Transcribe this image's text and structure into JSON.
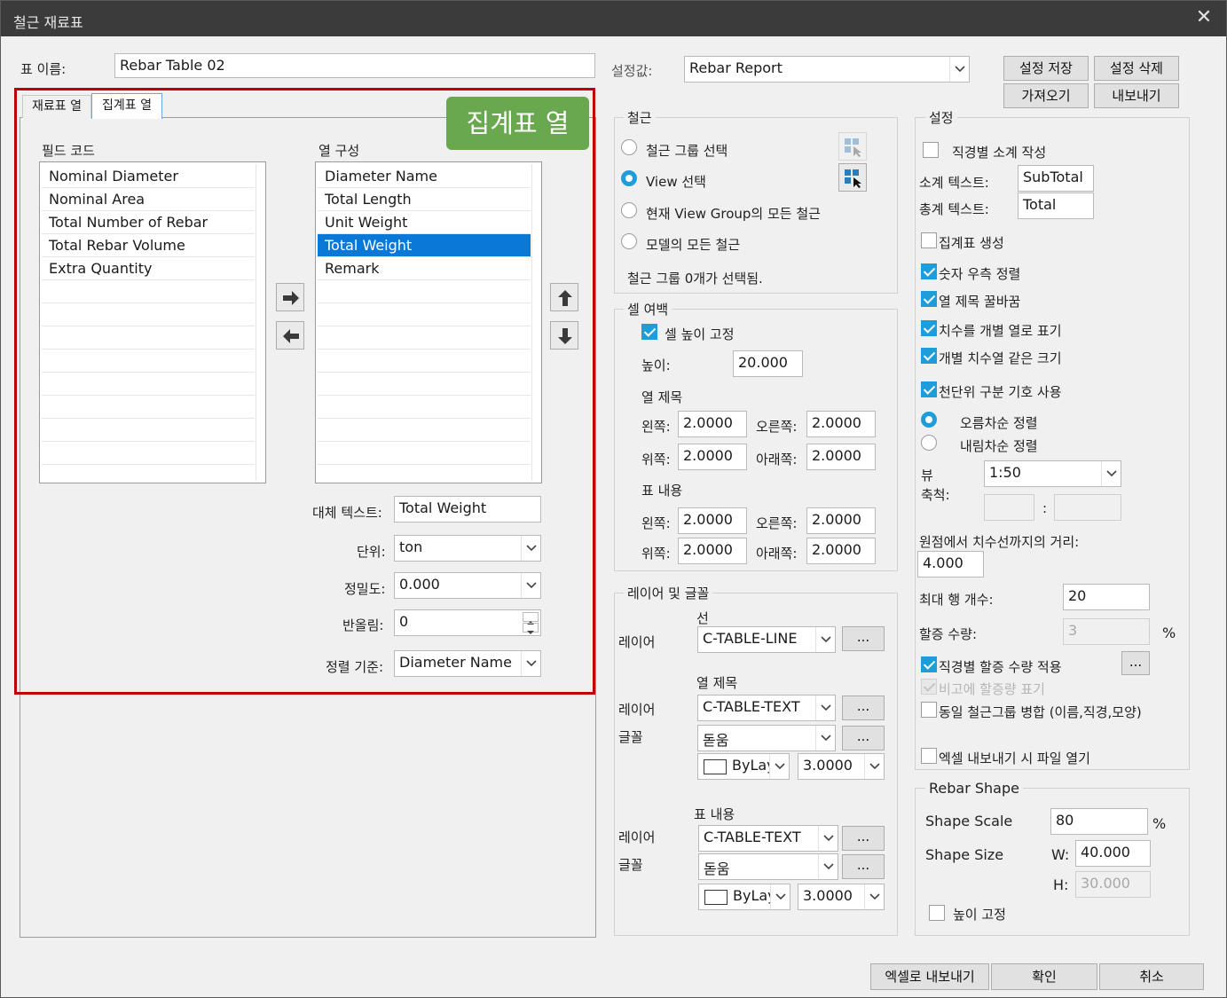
{
  "window": {
    "title": "철근 재료표",
    "close": "✕"
  },
  "top": {
    "table_name_label": "표 이름:",
    "table_name_value": "Rebar Table 02",
    "preset_label": "설정값:",
    "preset_value": "Rebar Report",
    "buttons": {
      "save": "설정 저장",
      "delete": "설정 삭제",
      "import": "가져오기",
      "export": "내보내기"
    }
  },
  "tabs": [
    {
      "label": "재료표 열"
    },
    {
      "label": "집계표 열"
    }
  ],
  "annotation": {
    "text": "집계표 열",
    "color": "#6aa84f",
    "frame_color": "#c00000"
  },
  "fields": {
    "label": "필드 코드",
    "items": [
      "Nominal Diameter",
      "Nominal Area",
      "Total Number of Rebar",
      "Total Rebar Volume",
      "Extra Quantity"
    ]
  },
  "columns": {
    "label": "열 구성",
    "items": [
      "Diameter Name",
      "Total Length",
      "Unit Weight",
      "Total Weight",
      "Remark"
    ],
    "selected_index": 3
  },
  "detail": {
    "alt_text_label": "대체 텍스트:",
    "alt_text_value": "Total Weight",
    "unit_label": "단위:",
    "unit_value": "ton",
    "precision_label": "정밀도:",
    "precision_value": "0.000",
    "rounding_label": "반올림:",
    "rounding_value": "0",
    "sort_label": "정렬 기준:",
    "sort_value": "Diameter Name"
  },
  "rebar": {
    "title": "철근",
    "opt_group": "철근 그룹 선택",
    "opt_view": "View 선택",
    "opt_current": "현재 View Group의 모든 철근",
    "opt_model": "모델의 모든 철근",
    "status": "철근 그룹 0개가 선택됨.",
    "selected": "view"
  },
  "margin": {
    "title": "셀 여백",
    "fix_height_label": "셀 높이 고정",
    "fix_height": true,
    "height_label": "높이:",
    "height_value": "20.000",
    "header_label": "열 제목",
    "body_label": "표 내용",
    "left_label": "왼쪽:",
    "right_label": "오른쪽:",
    "top_label": "위쪽:",
    "bottom_label": "아래쪽:",
    "header_left": "2.0000",
    "header_right": "2.0000",
    "header_top": "2.0000",
    "header_bottom": "2.0000",
    "body_left": "2.0000",
    "body_right": "2.0000",
    "body_top": "2.0000",
    "body_bottom": "2.0000"
  },
  "layers": {
    "title": "레이어 및 글꼴",
    "line_label": "선",
    "layer_label": "레이어",
    "font_label": "글꼴",
    "header_label": "열 제목",
    "body_label": "표 내용",
    "line_layer": "C-TABLE-LINE",
    "header_layer": "C-TABLE-TEXT",
    "header_font": "돋움",
    "header_color": "ByLayer",
    "header_size": "3.0000",
    "body_layer": "C-TABLE-TEXT",
    "body_font": "돋움",
    "body_color": "ByLayer",
    "body_size": "3.0000",
    "more": "..."
  },
  "settings": {
    "title": "설정",
    "subtotal_by_dia": "직경별 소계 작성",
    "subtotal_text_label": "소계 텍스트:",
    "subtotal_text": "SubTotal",
    "total_text_label": "총계 텍스트:",
    "total_text": "Total",
    "create_summary": "집계표 생성",
    "num_right": "숫자 우측 정렬",
    "header_fill": "열 제목 꿀바꿈",
    "dims_separate": "치수를 개별 열로 표기",
    "same_size": "개별 치수열 같은 크기",
    "thousand_sep": "천단위 구분 기호 사용",
    "asc": "오름차순 정렬",
    "desc": "내림차순 정렬",
    "view_scale_label_1": "뷰",
    "view_scale_label_2": "축척:",
    "view_scale": "1:50",
    "ratio_sep": ":",
    "dist_label": "원점에서 치수선까지의 거리:",
    "dist_value": "4.000",
    "max_rows_label": "최대 행 개수:",
    "max_rows": "20",
    "extra_label": "할증 수량:",
    "extra_value": "3",
    "extra_unit": "%",
    "apply_extra": "직경별 할증 수량 적용",
    "show_extra": "비고에 할증량 표기",
    "merge_groups": "동일 철근그룹 병합 (이름,직경,모양)",
    "open_excel": "엑셀 내보내기 시 파일 열기"
  },
  "shape": {
    "title": "Rebar Shape",
    "scale_label": "Shape Scale",
    "scale_value": "80",
    "scale_unit": "%",
    "size_label": "Shape Size",
    "w_label": "W:",
    "w_value": "40.000",
    "h_label": "H:",
    "h_value": "30.000",
    "fix_height": "높이 고정"
  },
  "bottom": {
    "excel": "엑셀로 내보내기",
    "ok": "확인",
    "cancel": "취소"
  }
}
